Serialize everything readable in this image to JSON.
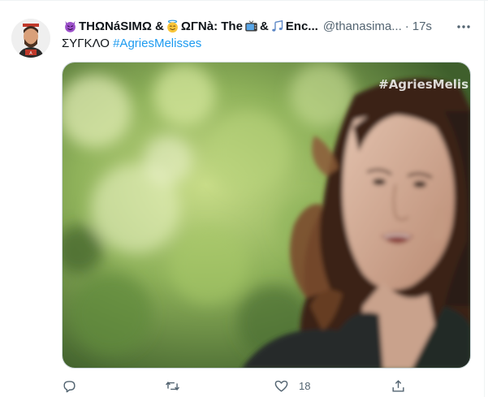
{
  "tweet": {
    "name_part1": "ΤΗΩΝáSIMΩ & ",
    "name_part2": "ΩΓΝà: The ",
    "name_part3": " & ",
    "name_part4": " Enc...",
    "handle": "@thanasima...",
    "separator": "·",
    "time": "17s",
    "text_prefix": "ΣΥΓΚΛΟ ",
    "hashtag": "#AgriesMelisses",
    "media_watermark": "#AgriesMelis",
    "avatar_label": "A",
    "icons": [
      "devil-emoji-icon",
      "angel-emoji-icon",
      "tv-emoji-icon",
      "music-notes-emoji-icon",
      "more-icon",
      "reply-icon",
      "retweet-icon",
      "like-icon",
      "share-icon"
    ]
  },
  "actions": {
    "reply_count": "",
    "retweet_count": "",
    "like_count": "18"
  },
  "colors": {
    "accent": "#1d9bf0",
    "secondary_text": "#536471",
    "border": "#cfd9de"
  }
}
